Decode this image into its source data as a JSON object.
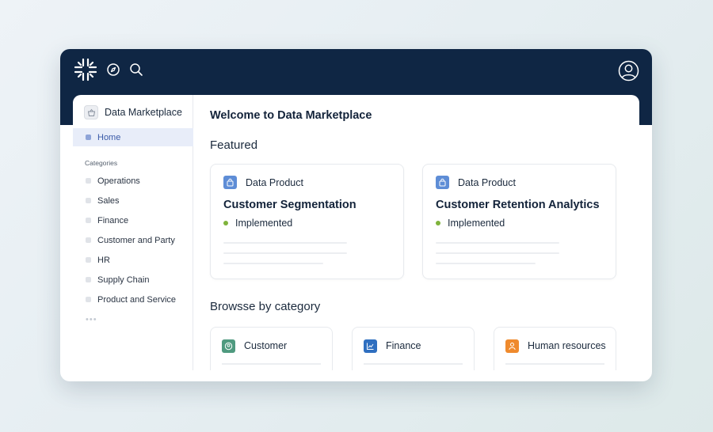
{
  "topbar": {
    "logo_icon": "asterisk-logo-icon",
    "explore_icon": "compass-icon",
    "search_icon": "search-icon",
    "profile_icon": "user-circle-icon"
  },
  "sidebar": {
    "app_title": "Data Marketplace",
    "home_label": "Home",
    "categories_heading": "Categories",
    "categories": [
      {
        "label": "Operations"
      },
      {
        "label": "Sales"
      },
      {
        "label": "Finance"
      },
      {
        "label": "Customer and Party"
      },
      {
        "label": "HR"
      },
      {
        "label": "Supply Chain"
      },
      {
        "label": "Product and Service"
      }
    ],
    "more": "•••"
  },
  "main": {
    "welcome": "Welcome to Data Marketplace",
    "featured_heading": "Featured",
    "featured": [
      {
        "type": "Data Product",
        "title": "Customer Segmentation",
        "status": "Implemented"
      },
      {
        "type": "Data Product",
        "title": "Customer Retention Analytics",
        "status": "Implemented"
      }
    ],
    "browse_heading": "Browsse by category",
    "browse": [
      {
        "label": "Customer",
        "color": "#4f9a7f"
      },
      {
        "label": "Finance",
        "color": "#2f6fc0"
      },
      {
        "label": "Human resources",
        "color": "#ef8a2d"
      }
    ]
  },
  "colors": {
    "topbar": "#0f2644",
    "accent": "#3a5aa8",
    "status_green": "#7fb33b",
    "product_icon": "#5e8dd6"
  }
}
